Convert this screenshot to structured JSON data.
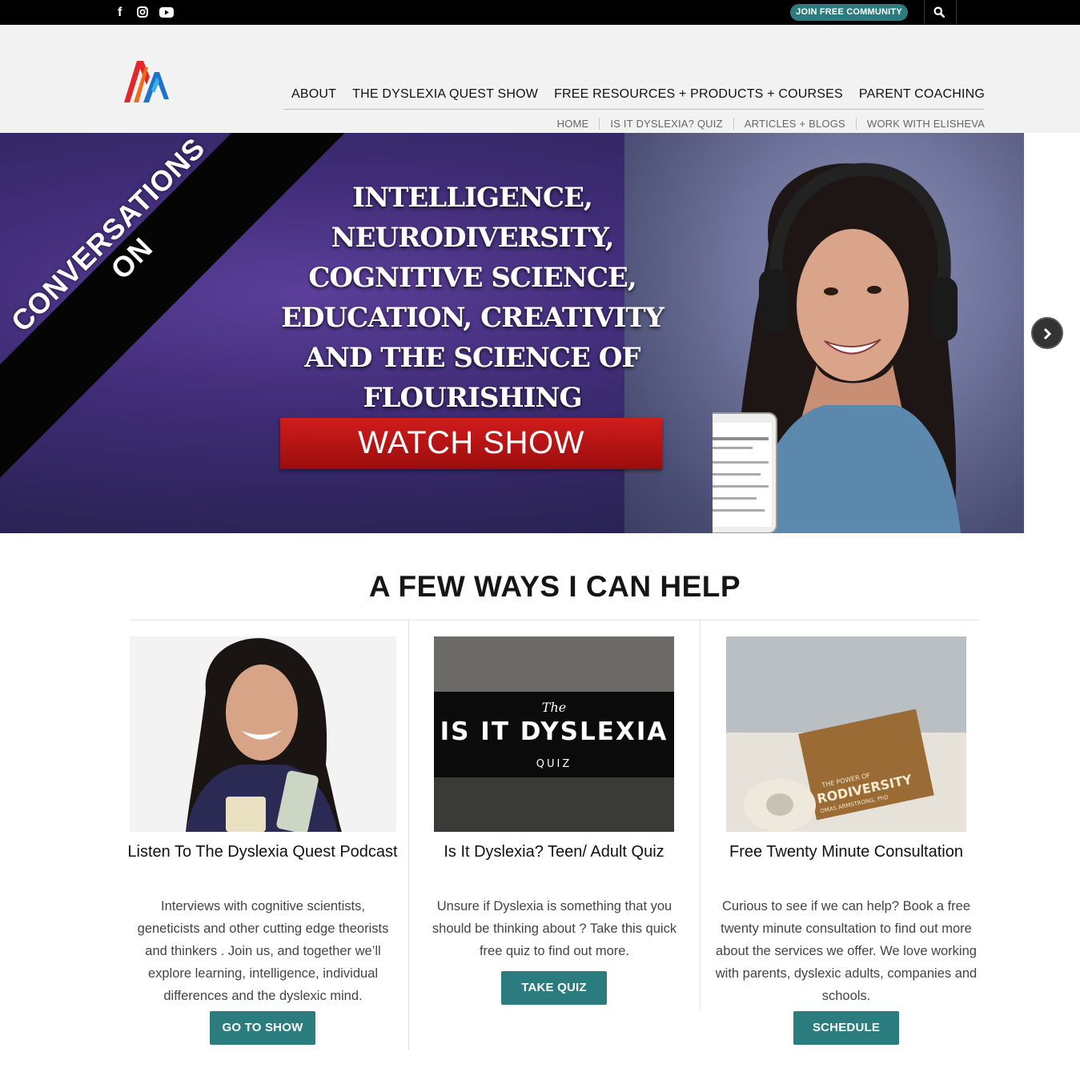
{
  "topbar": {
    "social_icons": [
      "facebook-icon",
      "instagram-icon",
      "youtube-icon"
    ],
    "join_label": "JOIN FREE COMMUNITY",
    "accent": "#2b7c7f"
  },
  "nav": {
    "main": [
      "ABOUT",
      "THE DYSLEXIA QUEST SHOW",
      "FREE RESOURCES + PRODUCTS + COURSES",
      "PARENT COACHING"
    ],
    "sub": [
      "HOME",
      "IS IT DYSLEXIA? QUIZ",
      "ARTICLES + BLOGS",
      "WORK WITH ELISHEVA"
    ]
  },
  "hero": {
    "banner": "CONVERSATIONS ON",
    "title": "INTELLIGENCE, NEURODIVERSITY, COGNITIVE SCIENCE, EDUCATION, CREATIVITY AND THE SCIENCE OF FLOURISHING",
    "cta": "WATCH SHOW",
    "cta_color": "#c01414"
  },
  "help": {
    "title": "A FEW WAYS I CAN HELP",
    "cards": [
      {
        "title": "Listen To The Dyslexia Quest Podcast",
        "text": "Interviews with cognitive scientists, geneticists and other cutting edge theorists and thinkers . Join us, and together we’ll explore learning, intelligence, individual differences and the dyslexic mind.",
        "button": "GO TO SHOW"
      },
      {
        "title": "Is It Dyslexia? Teen/ Adult Quiz",
        "text": "Unsure if Dyslexia is something that you should be thinking about ? Take this quick free quiz to find out more.",
        "button": "TAKE QUIZ",
        "image_text": {
          "pre": "The",
          "main": "IS IT DYSLEXIA",
          "sub": "QUIZ"
        }
      },
      {
        "title": "Free Twenty Minute Consultation",
        "text": "Curious to see if we can help? Book a free twenty minute consultation to find out more about the services we offer. We love working with parents, dyslexic adults, companies and schools.",
        "button": "SCHEDULE",
        "image_text": {
          "main": "THE POWER OF RODIVERSITY",
          "sub": "OMAS ARMSTRONG, PhD"
        }
      }
    ]
  }
}
